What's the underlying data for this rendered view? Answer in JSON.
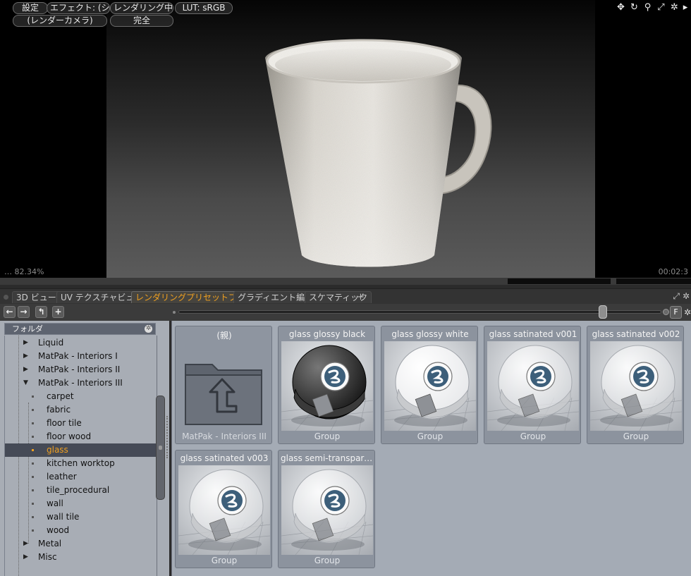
{
  "viewport": {
    "settings_label": "設定",
    "effect_label": "エフェクト: (シ…",
    "render_status": "レンダリング中…",
    "lut_label": "LUT: sRGB",
    "camera_label": "(レンダーカメラ)",
    "quality_label": "完全",
    "zoom_readout": "… 82.34%",
    "time_readout": "00:02:3",
    "icons": [
      "move-icon",
      "rotate-icon",
      "zoom-icon",
      "fit-icon",
      "gear-icon",
      "play-icon"
    ]
  },
  "tabs": [
    {
      "label": "3D ビュー",
      "active": false
    },
    {
      "label": "UV テクスチャビュー",
      "active": false
    },
    {
      "label": "レンダリングプリセットブラウザ",
      "active": true
    },
    {
      "label": "グラディエント編集",
      "active": false
    },
    {
      "label": "スケマティック",
      "active": false
    }
  ],
  "tab_add_label": "+",
  "toolbar": {
    "back_glyph": "←",
    "forward_glyph": "→",
    "up_glyph": "↰",
    "add_glyph": "+",
    "f_label": "F",
    "thumb_size_fraction": 0.89
  },
  "tree": {
    "header": "フォルダ",
    "items": [
      {
        "label": "Liquid",
        "level": 0,
        "expanded": false,
        "selected": false
      },
      {
        "label": "MatPak - Interiors I",
        "level": 0,
        "expanded": false,
        "selected": false
      },
      {
        "label": "MatPak - Interiors II",
        "level": 0,
        "expanded": false,
        "selected": false
      },
      {
        "label": "MatPak - Interiors III",
        "level": 0,
        "expanded": true,
        "selected": false
      },
      {
        "label": "carpet",
        "level": 1,
        "selected": false
      },
      {
        "label": "fabric",
        "level": 1,
        "selected": false
      },
      {
        "label": "floor tile",
        "level": 1,
        "selected": false
      },
      {
        "label": "floor wood",
        "level": 1,
        "selected": false
      },
      {
        "label": "glass",
        "level": 1,
        "selected": true
      },
      {
        "label": "kitchen worktop",
        "level": 1,
        "selected": false
      },
      {
        "label": "leather",
        "level": 1,
        "selected": false
      },
      {
        "label": "tile_procedural",
        "level": 1,
        "selected": false
      },
      {
        "label": "wall",
        "level": 1,
        "selected": false
      },
      {
        "label": "wall tile",
        "level": 1,
        "selected": false
      },
      {
        "label": "wood",
        "level": 1,
        "selected": false
      },
      {
        "label": "Metal",
        "level": 0,
        "expanded": false,
        "selected": false
      },
      {
        "label": "Misc",
        "level": 0,
        "expanded": false,
        "selected": false
      }
    ]
  },
  "presets": [
    {
      "title": "(親)",
      "subtitle": "MatPak - Interiors III",
      "kind": "parent"
    },
    {
      "title": "glass glossy black",
      "subtitle": "Group",
      "kind": "black"
    },
    {
      "title": "glass glossy white",
      "subtitle": "Group",
      "kind": "white"
    },
    {
      "title": "glass satinated v001",
      "subtitle": "Group",
      "kind": "satin"
    },
    {
      "title": "glass satinated v002",
      "subtitle": "Group",
      "kind": "satin"
    },
    {
      "title": "glass satinated v003",
      "subtitle": "Group",
      "kind": "satin"
    },
    {
      "title": "glass semi-transparen …",
      "subtitle": "Group",
      "kind": "satin"
    }
  ],
  "colors": {
    "accent": "#f0a020",
    "tree_bg": "#a8adb5",
    "grid_bg": "#a4abb5",
    "card_bg": "#8c939e"
  }
}
